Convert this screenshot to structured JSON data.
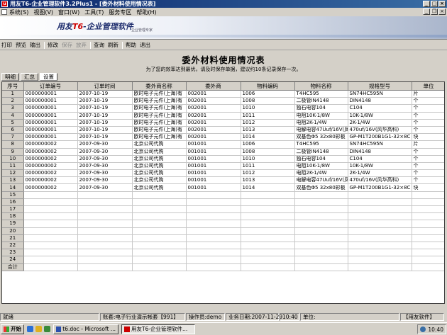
{
  "window": {
    "title": "用友T6-企业管理软件3.2Plus1 - [委外材料使用情况表]"
  },
  "menu": [
    "系统(S)",
    "视图(V)",
    "窗口(W)",
    "工具(T)",
    "服务专区",
    "帮助(H)"
  ],
  "banner": {
    "logo_prefix": "用友",
    "logo_t6": "T6",
    "logo_suffix": "-企业管理软件",
    "sub": "企业管理专家"
  },
  "toolbar": [
    {
      "label": "打印",
      "enabled": true
    },
    {
      "label": "预览",
      "enabled": true
    },
    {
      "label": "输出",
      "enabled": true
    },
    {
      "sep": true
    },
    {
      "label": "修改",
      "enabled": true
    },
    {
      "label": "保存",
      "enabled": false
    },
    {
      "label": "放弃",
      "enabled": false
    },
    {
      "sep": true
    },
    {
      "label": "查询",
      "enabled": true
    },
    {
      "label": "刷新",
      "enabled": true
    },
    {
      "sep": true
    },
    {
      "label": "帮助",
      "enabled": true
    },
    {
      "label": "退出",
      "enabled": true
    }
  ],
  "form": {
    "title": "委外材料使用情况表",
    "hint": "为了您的效率达到最优，请及时保存单据，建议约10条记录保存一次。"
  },
  "tabs": [
    {
      "label": "明细",
      "active": false
    },
    {
      "label": "汇总",
      "active": false
    },
    {
      "label": "设置",
      "active": true
    }
  ],
  "grid": {
    "headers": [
      "序号",
      "订单编号",
      "订单时间",
      "委外商名称",
      "委外商",
      "物料编码",
      "物料名称",
      "规格型号",
      "单位"
    ],
    "rows": [
      [
        "1",
        "0000000001",
        "2007-10-19",
        "欧时电子元件(上海)有",
        "002001",
        "1006",
        "T4HC595",
        "SN74HC595N",
        "片"
      ],
      [
        "2",
        "0000000001",
        "2007-10-19",
        "欧时电子元件(上海)有",
        "002001",
        "1008",
        "二极管IN4148",
        "DIN4148",
        "个"
      ],
      [
        "3",
        "0000000001",
        "2007-10-19",
        "欧时电子元件(上海)有",
        "002001",
        "1010",
        "独石电容104",
        "C104",
        "个"
      ],
      [
        "4",
        "0000000001",
        "2007-10-19",
        "欧时电子元件(上海)有",
        "002001",
        "1011",
        "电阻10K-1/8W",
        "10K-1/8W",
        "个"
      ],
      [
        "5",
        "0000000001",
        "2007-10-19",
        "欧时电子元件(上海)有",
        "002001",
        "1012",
        "电阻2K-1/4W",
        "2K-1/4W",
        "个"
      ],
      [
        "6",
        "0000000001",
        "2007-10-19",
        "欧时电子元件(上海)有",
        "002001",
        "1013",
        "电解电容47Uuf/16V(凤",
        "470uf/16V(风华高科)",
        "个"
      ],
      [
        "7",
        "0000000001",
        "2007-10-19",
        "欧时电子元件(上海)有",
        "002001",
        "1014",
        "双基色Φ5 32x80彩板",
        "GP-M1T200B1G1-32×8C",
        "块"
      ],
      [
        "8",
        "0000000002",
        "2007-09-30",
        "北京公司代购",
        "001001",
        "1006",
        "T4HC595",
        "SN74HC595N",
        "片"
      ],
      [
        "9",
        "0000000002",
        "2007-09-30",
        "北京公司代购",
        "001001",
        "1008",
        "二极管IN4148",
        "DIN4148",
        "个"
      ],
      [
        "10",
        "0000000002",
        "2007-09-30",
        "北京公司代购",
        "001001",
        "1010",
        "独石电容104",
        "C104",
        "个"
      ],
      [
        "11",
        "0000000002",
        "2007-09-30",
        "北京公司代购",
        "001001",
        "1011",
        "电阻10K-1/8W",
        "10K-1/8W",
        "个"
      ],
      [
        "12",
        "0000000002",
        "2007-09-30",
        "北京公司代购",
        "001001",
        "1012",
        "电阻2K-1/4W",
        "2K-1/4W",
        "个"
      ],
      [
        "13",
        "0000000002",
        "2007-09-30",
        "北京公司代购",
        "001001",
        "1013",
        "电解电容47Uuf/16V(凤",
        "470uf/16V(风华高科)",
        "个"
      ],
      [
        "14",
        "0000000002",
        "2007-09-30",
        "北京公司代购",
        "001001",
        "1014",
        "双基色Φ5 32x80彩板",
        "GP-M1T200B1G1-32×8C",
        "块"
      ],
      [
        "15",
        "",
        "",
        "",
        "",
        "",
        "",
        "",
        ""
      ],
      [
        "16",
        "",
        "",
        "",
        "",
        "",
        "",
        "",
        ""
      ],
      [
        "17",
        "",
        "",
        "",
        "",
        "",
        "",
        "",
        ""
      ],
      [
        "18",
        "",
        "",
        "",
        "",
        "",
        "",
        "",
        ""
      ],
      [
        "19",
        "",
        "",
        "",
        "",
        "",
        "",
        "",
        ""
      ],
      [
        "20",
        "",
        "",
        "",
        "",
        "",
        "",
        "",
        ""
      ],
      [
        "21",
        "",
        "",
        "",
        "",
        "",
        "",
        "",
        ""
      ],
      [
        "22",
        "",
        "",
        "",
        "",
        "",
        "",
        "",
        ""
      ],
      [
        "23",
        "",
        "",
        "",
        "",
        "",
        "",
        "",
        ""
      ],
      [
        "24",
        "",
        "",
        "",
        "",
        "",
        "",
        "",
        ""
      ],
      [
        "合计",
        "",
        "",
        "",
        "",
        "",
        "",
        "",
        ""
      ]
    ]
  },
  "status": {
    "ready": "就绪",
    "account": "账套:电子行业演示帐套【991】",
    "operator": "操作员:demo",
    "date": "业务日期:2007-11-29",
    "time": "10:40",
    "unit": "单位:",
    "brand": "【用友软件】"
  },
  "taskbar": {
    "start": "开始",
    "items": [
      {
        "label": "t6.doc - Microsoft ...",
        "active": false
      },
      {
        "label": "用友T6-企业管理软件...",
        "active": true
      }
    ],
    "clock": "10:40"
  },
  "colors": {
    "title_start": "#0a246a",
    "title_end": "#3a6ea5",
    "face": "#d4d0c8"
  },
  "icons": [
    "app-icon",
    "doc-icon",
    "start-flag-icon",
    "ie-icon",
    "outlook-icon",
    "desktop-icon",
    "word-icon",
    "t6-icon",
    "volume-icon"
  ]
}
